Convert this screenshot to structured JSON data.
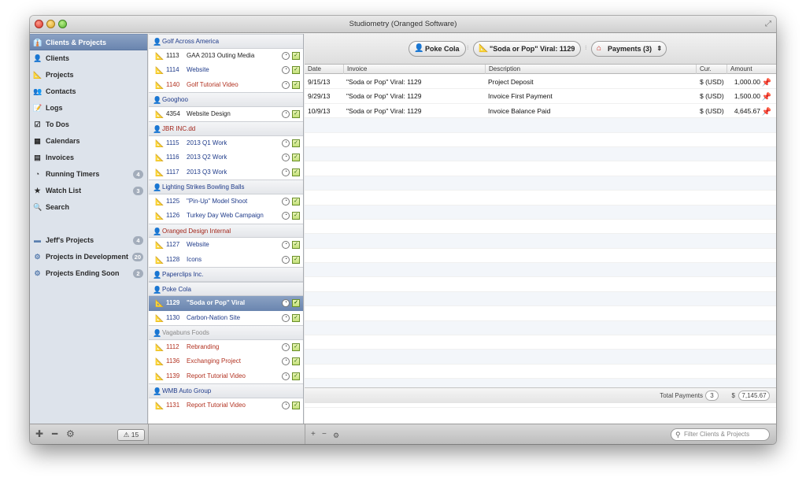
{
  "window": {
    "title": "Studiometry (Oranged Software)"
  },
  "sidebar": {
    "items": [
      {
        "label": "Clients & Projects",
        "icon": "clients-projects-icon",
        "glyph": "👔",
        "selected": true
      },
      {
        "label": "Clients",
        "icon": "person-icon",
        "glyph": "👤"
      },
      {
        "label": "Projects",
        "icon": "projects-icon",
        "glyph": "📐"
      },
      {
        "label": "Contacts",
        "icon": "contacts-icon",
        "glyph": "👥"
      },
      {
        "label": "Logs",
        "icon": "logs-icon",
        "glyph": "📝"
      },
      {
        "label": "To Dos",
        "icon": "todo-checkbox-icon",
        "glyph": "☑"
      },
      {
        "label": "Calendars",
        "icon": "calendar-icon",
        "glyph": "▦"
      },
      {
        "label": "Invoices",
        "icon": "invoice-icon",
        "glyph": "▤"
      },
      {
        "label": "Running Timers",
        "icon": "timer-icon",
        "glyph": "◔",
        "badge": "4"
      },
      {
        "label": "Watch List",
        "icon": "star-icon",
        "glyph": "★",
        "badge": "3"
      },
      {
        "label": "Search",
        "icon": "magnifier-icon",
        "glyph": "🔍"
      }
    ],
    "smart_groups": [
      {
        "label": "Jeff's Projects",
        "icon": "folder-icon",
        "glyph": "▬",
        "badge": "4"
      },
      {
        "label": "Projects in Development",
        "icon": "smart-folder-icon",
        "glyph": "⚙",
        "badge": "20"
      },
      {
        "label": "Projects Ending Soon",
        "icon": "smart-folder-icon",
        "glyph": "⚙",
        "badge": "2"
      }
    ],
    "warning_count": "15"
  },
  "projects_list": [
    {
      "type": "client",
      "name": "Golf Across America",
      "color": "blue"
    },
    {
      "type": "project",
      "num": "1113",
      "name": "GAA 2013 Outing Media",
      "color": "black"
    },
    {
      "type": "project",
      "num": "1114",
      "name": "Website",
      "color": "blue"
    },
    {
      "type": "project",
      "num": "1140",
      "name": "Golf Tutorial Video",
      "color": "red"
    },
    {
      "type": "client",
      "name": "Googhoo",
      "color": "blue"
    },
    {
      "type": "project",
      "num": "4354",
      "name": "Website Design",
      "color": "black"
    },
    {
      "type": "client",
      "name": "JBR INC.dd",
      "color": "red"
    },
    {
      "type": "project",
      "num": "1115",
      "name": "2013 Q1 Work",
      "color": "blue"
    },
    {
      "type": "project",
      "num": "1116",
      "name": "2013 Q2 Work",
      "color": "blue"
    },
    {
      "type": "project",
      "num": "1117",
      "name": "2013 Q3 Work",
      "color": "blue"
    },
    {
      "type": "client",
      "name": "Lighting Strikes Bowling Balls",
      "color": "blue"
    },
    {
      "type": "project",
      "num": "1125",
      "name": "\"Pin-Up\" Model Shoot",
      "color": "blue"
    },
    {
      "type": "project",
      "num": "1126",
      "name": "Turkey Day Web Campaign",
      "color": "blue"
    },
    {
      "type": "client",
      "name": "Oranged Design Internal",
      "color": "red"
    },
    {
      "type": "project",
      "num": "1127",
      "name": "Website",
      "color": "blue"
    },
    {
      "type": "project",
      "num": "1128",
      "name": "Icons",
      "color": "blue"
    },
    {
      "type": "client",
      "name": "Paperclips Inc.",
      "color": "blue"
    },
    {
      "type": "client",
      "name": "Poke Cola",
      "color": "blue"
    },
    {
      "type": "project",
      "num": "1129",
      "name": "\"Soda or Pop\" Viral",
      "color": "blue",
      "selected": true
    },
    {
      "type": "project",
      "num": "1130",
      "name": "Carbon-Nation Site",
      "color": "blue"
    },
    {
      "type": "client",
      "name": "Vagabuns Foods",
      "color": "grey"
    },
    {
      "type": "project",
      "num": "1112",
      "name": "Rebranding",
      "color": "red"
    },
    {
      "type": "project",
      "num": "1136",
      "name": "Exchanging Project",
      "color": "red"
    },
    {
      "type": "project",
      "num": "1139",
      "name": "Report Tutorial Video",
      "color": "red"
    },
    {
      "type": "client",
      "name": "WMB Auto Group",
      "color": "blue"
    },
    {
      "type": "project",
      "num": "1131",
      "name": "Report Tutorial Video",
      "color": "red"
    }
  ],
  "breadcrumb": {
    "client": "Poke Cola",
    "project": "\"Soda or Pop\" Viral: 1129",
    "section": "Payments (3)"
  },
  "table": {
    "columns": [
      "Date",
      "Invoice",
      "Description",
      "Cur.",
      "Amount"
    ],
    "rows": [
      {
        "date": "9/15/13",
        "invoice": "\"Soda or Pop\" Viral: 1129",
        "description": "Project Deposit",
        "currency": "$ (USD)",
        "amount": "1,000.00"
      },
      {
        "date": "9/29/13",
        "invoice": "\"Soda or Pop\" Viral: 1129",
        "description": "Invoice First Payment",
        "currency": "$ (USD)",
        "amount": "1,500.00"
      },
      {
        "date": "10/9/13",
        "invoice": "\"Soda or Pop\" Viral: 1129",
        "description": "Invoice Balance Paid",
        "currency": "$ (USD)",
        "amount": "4,645.67"
      }
    ],
    "empty_rows": 20
  },
  "totals": {
    "label": "Total Payments",
    "count": "3",
    "currency_symbol": "$",
    "amount": "7,145.67"
  },
  "search": {
    "placeholder": "Filter Clients & Projects"
  },
  "colors": {
    "selection": "#6a85af",
    "blue_text": "#1f3b8a",
    "red_text": "#b23221",
    "pin": "#c9231b"
  }
}
